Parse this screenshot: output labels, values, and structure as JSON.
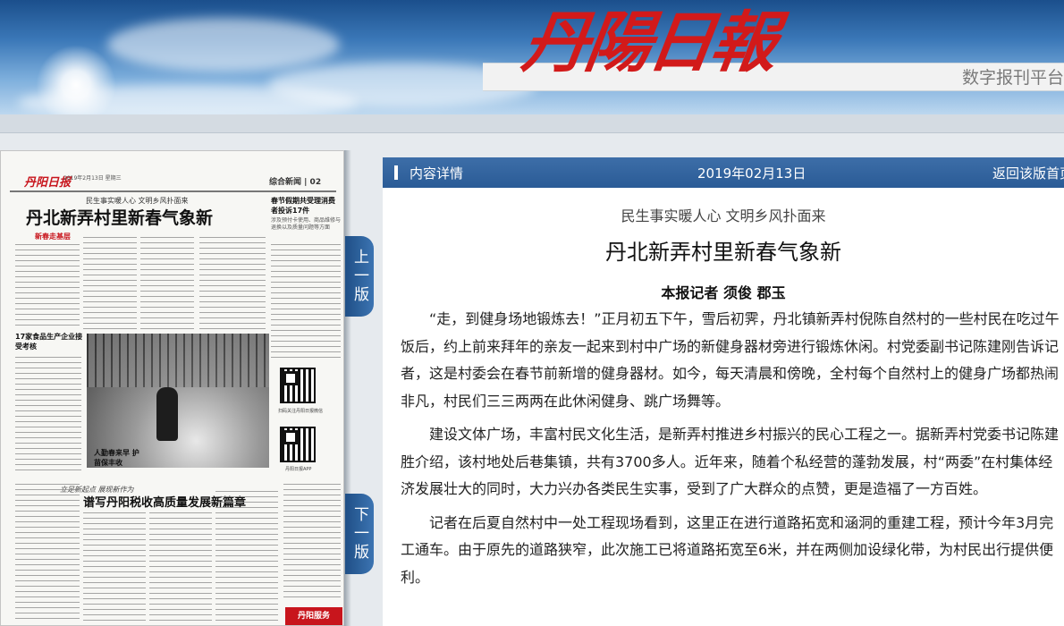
{
  "header": {
    "masthead": "丹陽日報",
    "subtitle": "数字报刊平台"
  },
  "thumbnail": {
    "logo": "丹阳日报",
    "info": "2019年2月13日 星期三",
    "section": "综合新闻 | 02",
    "kicker": "民生事实暖人心 文明乡风扑面来",
    "headline": "丹北新弄村里新春气象新",
    "badge": "新春走基层",
    "side_head": "春节假期共受理消费者投诉17件",
    "side_sub": "涉及预付卡使用、商品维修与退换以及质量问题等方面",
    "left_head": "17家食品生产企业接受考核",
    "photo_caption": "人勤春来早 护苗保丰收",
    "qr1_caption": "扫码关注丹阳日报微信",
    "qr2_caption": "丹阳日报APP",
    "banner": "立足新起点 展现新作为",
    "headline2": "谱写丹阳税收高质量发展新篇章",
    "ad": "丹阳服务"
  },
  "nav": {
    "prev_page": "上一版",
    "next_page": "下一版"
  },
  "article": {
    "bar_title": "内容详情",
    "date": "2019年02月13日",
    "back_label": "返回该版首页",
    "kicker": "民生事实暖人心 文明乡风扑面来",
    "headline": "丹北新弄村里新春气象新",
    "byline": "本报记者 须俊 郡玉",
    "paragraphs": [
      "“走，到健身场地锻炼去！”正月初五下午，雪后初霁，丹北镇新弄村倪陈自然村的一些村民在吃过午饭后，约上前来拜年的亲友一起来到村中广场的新健身器材旁进行锻炼休闲。村党委副书记陈建刚告诉记者，这是村委会在春节前新增的健身器材。如今，每天清晨和傍晚，全村每个自然村上的健身广场都热闹非凡，村民们三三两两在此休闲健身、跳广场舞等。",
      "建设文体广场，丰富村民文化生活，是新弄村推进乡村振兴的民心工程之一。据新弄村党委书记陈建胜介绍，该村地处后巷集镇，共有3700多人。近年来，随着个私经营的蓬勃发展，村“两委”在村集体经济发展壮大的同时，大力兴办各类民生实事，受到了广大群众的点赞，更是造福了一方百姓。",
      "记者在后夏自然村中一处工程现场看到，这里正在进行道路拓宽和涵洞的重建工程，预计今年3月完工通车。由于原先的道路狭窄，此次施工已将道路拓宽至6米，并在两侧加设绿化带，为村民出行提供便利。"
    ]
  },
  "colors": {
    "masthead_red": "#d21a1a",
    "bar_blue": "#2a5b96"
  }
}
